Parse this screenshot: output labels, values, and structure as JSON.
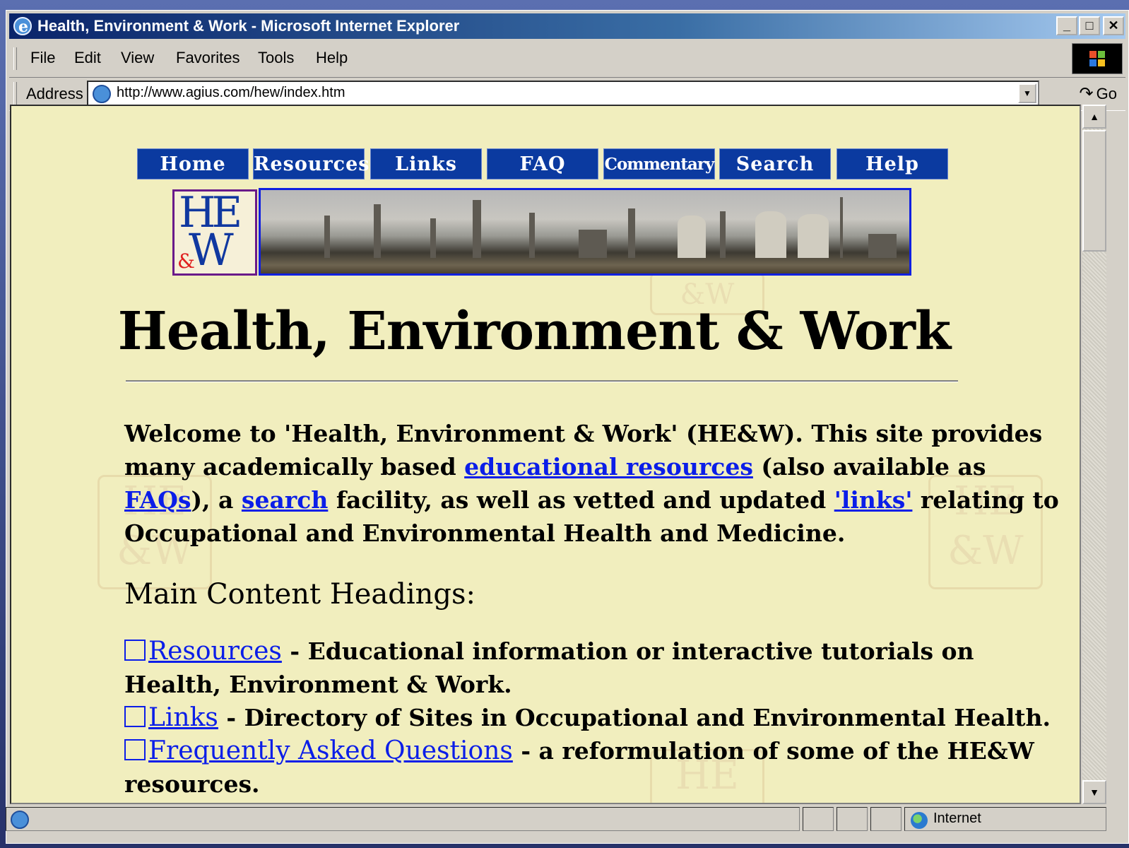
{
  "window": {
    "title": "Health, Environment & Work - Microsoft Internet Explorer",
    "controls": {
      "minimize": "_",
      "maximize": "□",
      "close": "✕"
    }
  },
  "menubar": {
    "items": [
      "File",
      "Edit",
      "View",
      "Favorites",
      "Tools",
      "Help"
    ]
  },
  "address": {
    "label": "Address",
    "url": "http://www.agius.com/hew/index.htm",
    "go_label": "Go"
  },
  "page": {
    "nav": [
      "Home",
      "Resources",
      "Links",
      "FAQ",
      "Commentary",
      "Search",
      "Help"
    ],
    "logo": {
      "he": "HE",
      "amp": "&",
      "w": "W"
    },
    "title": "Health, Environment & Work",
    "welcome": {
      "part1": "Welcome to 'Health, Environment & Work' (HE&W). This site provides many academically based ",
      "link_resources": "educational resources",
      "part2": " (also available as ",
      "link_faqs": "FAQs",
      "part3": "), a ",
      "link_search": "search",
      "part4": " facility, as well as vetted and updated ",
      "link_links": "'links'",
      "part5": " relating to Occupational and Environmental Health and Medicine."
    },
    "section_heading": "Main Content Headings:",
    "list": [
      {
        "link": "Resources",
        "text": " - Educational information or interactive tutorials on Health, Environment & Work."
      },
      {
        "link": "Links",
        "text": " - Directory of Sites in Occupational and Environmental Health."
      },
      {
        "link": "Frequently Asked Questions",
        "text": " - a reformulation of some of the HE&W resources."
      }
    ]
  },
  "statusbar": {
    "zone": "Internet"
  },
  "colors": {
    "page_background": "#f1eebe",
    "nav_button": "#0b3aa0",
    "link": "#0b1ee8",
    "title_bar_start": "#0a246a"
  }
}
